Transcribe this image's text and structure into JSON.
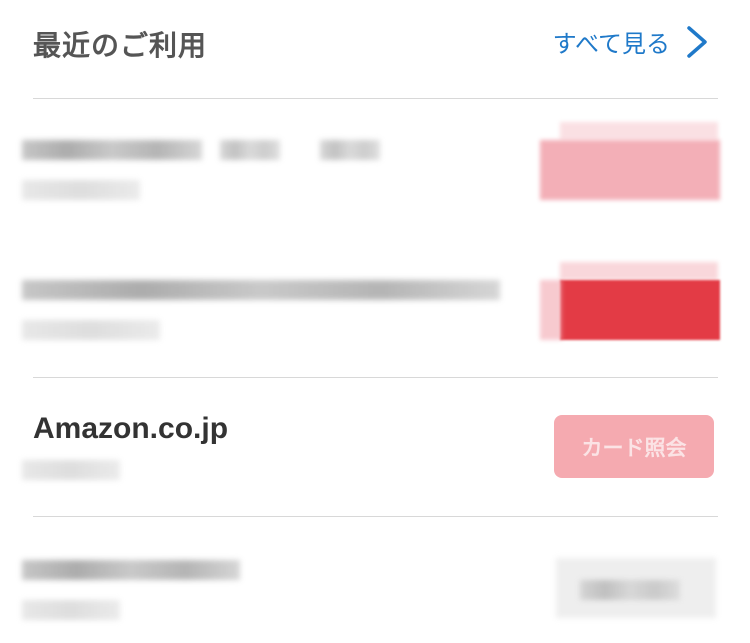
{
  "header": {
    "title": "最近のご利用",
    "see_all_label": "すべて見る"
  },
  "transactions": [
    {
      "merchant": "",
      "date": "",
      "button_label": "",
      "state": "blurred"
    },
    {
      "merchant": "",
      "date": "",
      "button_label": "",
      "state": "blurred-highlight"
    },
    {
      "merchant": "Amazon.co.jp",
      "date": "",
      "button_label": "カード照会",
      "state": "visible"
    },
    {
      "merchant": "",
      "date": "",
      "button_label": "",
      "state": "blurred"
    }
  ],
  "colors": {
    "accent_blue": "#1f79c9",
    "card_button_pink": "#f5aab0",
    "highlight_red": "#e33b45"
  },
  "icons": {
    "see_all": "chevron-right-icon"
  }
}
